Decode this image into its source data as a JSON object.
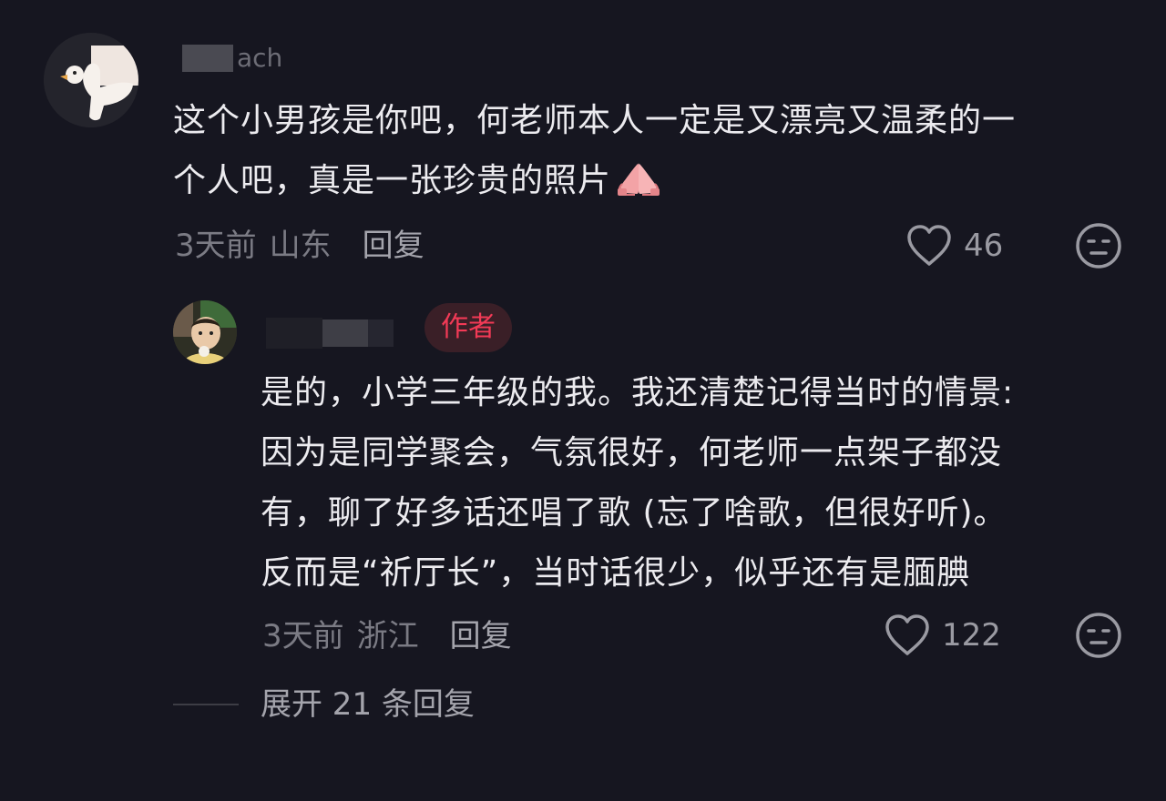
{
  "comment": {
    "username_partial": "ach",
    "lines": [
      "这个小男孩是你吧，何老师本人一定是又漂亮又温柔的一",
      "个人吧，真是一张珍贵的照片"
    ],
    "emoji_icon": "folded-hands-emoji",
    "time": "3天前",
    "location": "山东",
    "reply_label": "回复",
    "like_count": "46",
    "like_icon": "heart-outline-icon",
    "dislike_icon": "neutral-face-icon"
  },
  "reply": {
    "author_badge": "作者",
    "lines": [
      "是的，小学三年级的我。我还清楚记得当时的情景:",
      "因为是同学聚会，气氛很好，何老师一点架子都没",
      "有，聊了好多话还唱了歌 (忘了啥歌，但很好听)。",
      "反而是“祈厅长”，当时话很少，似乎还有是腼腆"
    ],
    "time": "3天前",
    "location": "浙江",
    "reply_label": "回复",
    "like_count": "122",
    "like_icon": "heart-outline-icon",
    "dislike_icon": "neutral-face-icon"
  },
  "expand_replies": "展开 21 条回复",
  "colors": {
    "background": "#161620",
    "text": "#ecebef",
    "meta": "#7b7b84",
    "author_badge": "#f23a56"
  }
}
